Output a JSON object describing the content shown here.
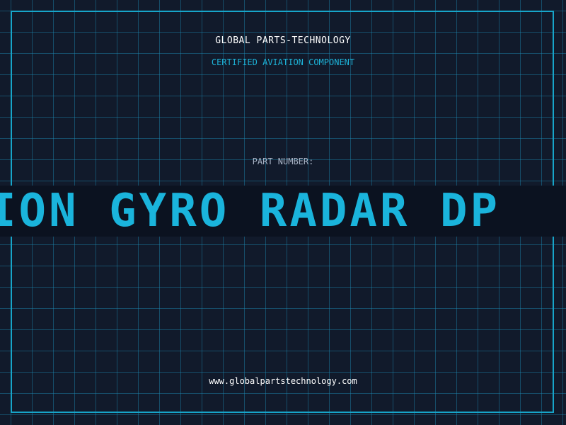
{
  "header": {
    "company": "GLOBAL PARTS-TECHNOLOGY",
    "tagline": "CERTIFIED AVIATION COMPONENT"
  },
  "part": {
    "label": "PART NUMBER:",
    "value": "ION GYRO RADAR DP"
  },
  "footer": {
    "website": "www.globalpartstechnology.com"
  },
  "colors": {
    "background": "#111a2b",
    "accent": "#1ab4dc",
    "frame": "#17a5c9"
  }
}
